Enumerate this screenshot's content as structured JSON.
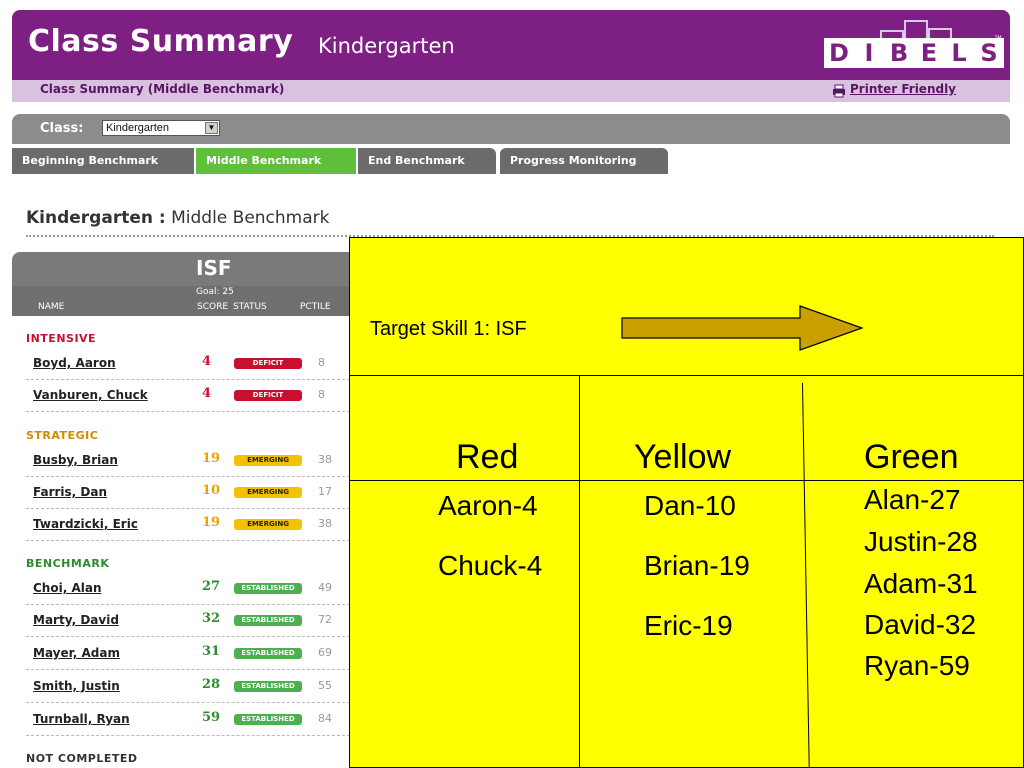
{
  "header": {
    "title": "Class Summary",
    "subtitle": "Kindergarten",
    "logo_text": "DIBELS",
    "logo_letters": [
      "D",
      "I",
      "B",
      "E",
      "L",
      "S"
    ],
    "trademark": "™"
  },
  "subheader": {
    "title": "Class Summary (Middle Benchmark)",
    "printer_link": "Printer Friendly"
  },
  "class_bar": {
    "label": "Class:",
    "select_value": "Kindergarten"
  },
  "tabs": [
    {
      "label": "Beginning Benchmark",
      "active": false
    },
    {
      "label": "Middle Benchmark",
      "active": true
    },
    {
      "label": "End Benchmark",
      "active": false
    },
    {
      "label": "Progress Monitoring",
      "active": false
    }
  ],
  "section": {
    "grade": "Kindergarten",
    "separator": " :",
    "period": "Middle Benchmark"
  },
  "isf_panel": {
    "title": "ISF",
    "goal": "Goal: 25",
    "columns": {
      "name": "NAME",
      "score": "SCORE",
      "status": "STATUS",
      "pctile": "PCTILE"
    },
    "groups": [
      {
        "label": "INTENSIVE",
        "color": "#c8102e",
        "students": [
          {
            "name": "Boyd, Aaron",
            "score": "4",
            "status": "DEFICIT",
            "pctile": "8"
          },
          {
            "name": "Vanburen, Chuck",
            "score": "4",
            "status": "DEFICIT",
            "pctile": "8"
          }
        ]
      },
      {
        "label": "STRATEGIC",
        "color": "#d08a00",
        "students": [
          {
            "name": "Busby, Brian",
            "score": "19",
            "status": "EMERGING",
            "pctile": "38"
          },
          {
            "name": "Farris, Dan",
            "score": "10",
            "status": "EMERGING",
            "pctile": "17"
          },
          {
            "name": "Twardzicki, Eric",
            "score": "19",
            "status": "EMERGING",
            "pctile": "38"
          }
        ]
      },
      {
        "label": "BENCHMARK",
        "color": "#2e8b2e",
        "students": [
          {
            "name": "Choi, Alan",
            "score": "27",
            "status": "ESTABLISHED",
            "pctile": "49"
          },
          {
            "name": "Marty, David",
            "score": "32",
            "status": "ESTABLISHED",
            "pctile": "72"
          },
          {
            "name": "Mayer, Adam",
            "score": "31",
            "status": "ESTABLISHED",
            "pctile": "69"
          },
          {
            "name": "Smith, Justin",
            "score": "28",
            "status": "ESTABLISHED",
            "pctile": "55"
          },
          {
            "name": "Turnball, Ryan",
            "score": "59",
            "status": "ESTABLISHED",
            "pctile": "84"
          }
        ]
      }
    ],
    "not_completed_label": "NOT COMPLETED"
  },
  "overlay": {
    "target_label": "Target Skill 1: ISF",
    "columns": [
      {
        "heading": "Red",
        "items": [
          "Aaron-4",
          "Chuck-4"
        ]
      },
      {
        "heading": "Yellow",
        "items": [
          "Dan-10",
          "Brian-19",
          "Eric-19"
        ]
      },
      {
        "heading": "Green",
        "items": [
          "Alan-27",
          "Justin-28",
          "Adam-31",
          "David-32",
          "Ryan-59"
        ]
      }
    ]
  },
  "colors": {
    "brand_purple": "#7e1f83",
    "tab_active": "#5fbf3a",
    "tab_inactive": "#6b6b6b",
    "overlay_yellow": "#ffff00",
    "arrow_fill": "#c9a000",
    "deficit": "#c8102e",
    "emerging": "#f2c200",
    "established": "#4caf50"
  },
  "icons": {
    "printer": "printer-icon",
    "dropdown": "chevron-down-icon",
    "arrow": "right-arrow-icon"
  }
}
